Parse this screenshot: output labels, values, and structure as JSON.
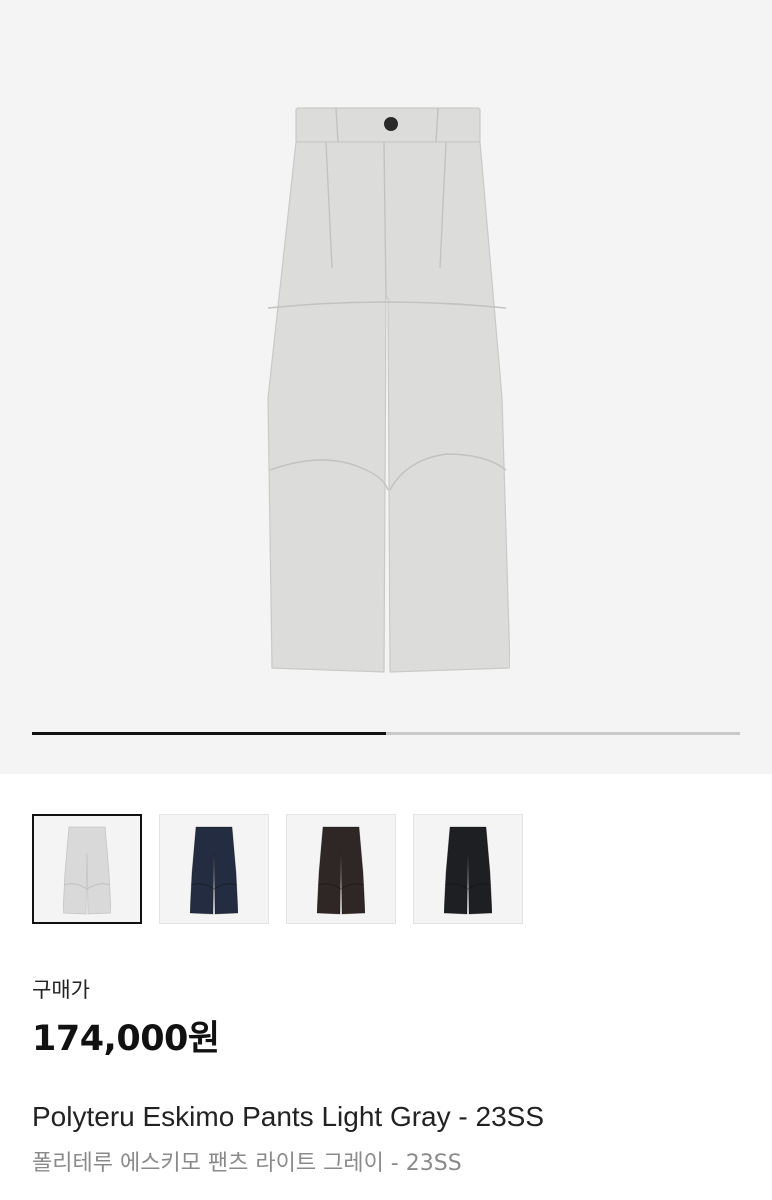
{
  "gallery": {
    "progress_fraction": 0.5,
    "thumbnails": [
      {
        "color_name": "light-gray",
        "color": "#d9d9d9",
        "selected": true
      },
      {
        "color_name": "navy",
        "color": "#232c40",
        "selected": false
      },
      {
        "color_name": "brown",
        "color": "#2f2725",
        "selected": false
      },
      {
        "color_name": "black",
        "color": "#1e1f23",
        "selected": false
      }
    ]
  },
  "product": {
    "price_label": "구매가",
    "price": "174,000원",
    "name_en": "Polyteru Eskimo Pants Light Gray - 23SS",
    "name_ko": "폴리테루 에스키모 팬츠 라이트 그레이 - 23SS"
  }
}
